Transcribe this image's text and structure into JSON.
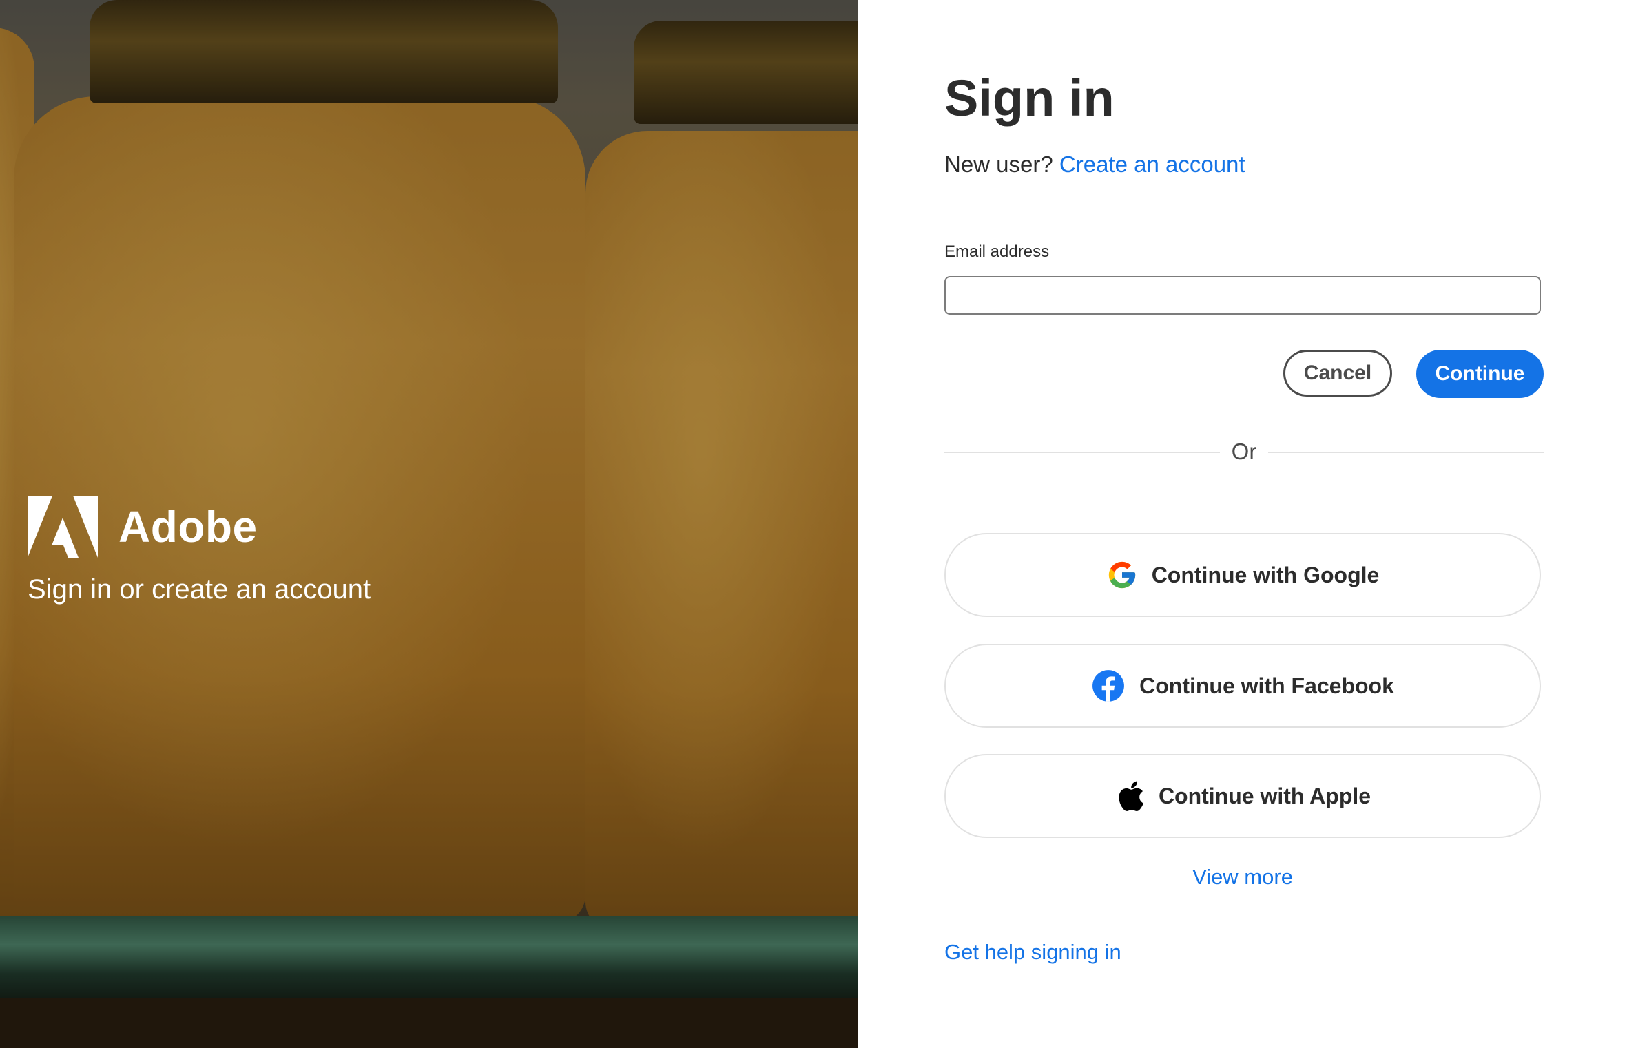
{
  "brand": {
    "name": "Adobe",
    "subtitle": "Sign in or create an account"
  },
  "form": {
    "title": "Sign in",
    "new_user_prompt": "New user?",
    "create_account_link": "Create an account",
    "email_label": "Email address",
    "email_value": "",
    "cancel_label": "Cancel",
    "continue_label": "Continue",
    "divider_text": "Or"
  },
  "social": [
    {
      "label": "Continue with Google",
      "icon": "google-icon"
    },
    {
      "label": "Continue with Facebook",
      "icon": "facebook-icon"
    },
    {
      "label": "Continue with Apple",
      "icon": "apple-icon"
    }
  ],
  "links": {
    "view_more": "View more",
    "help": "Get help signing in"
  },
  "colors": {
    "accent": "#1473e6",
    "text": "#2c2c2c",
    "panel_bg": "#ffffff"
  }
}
